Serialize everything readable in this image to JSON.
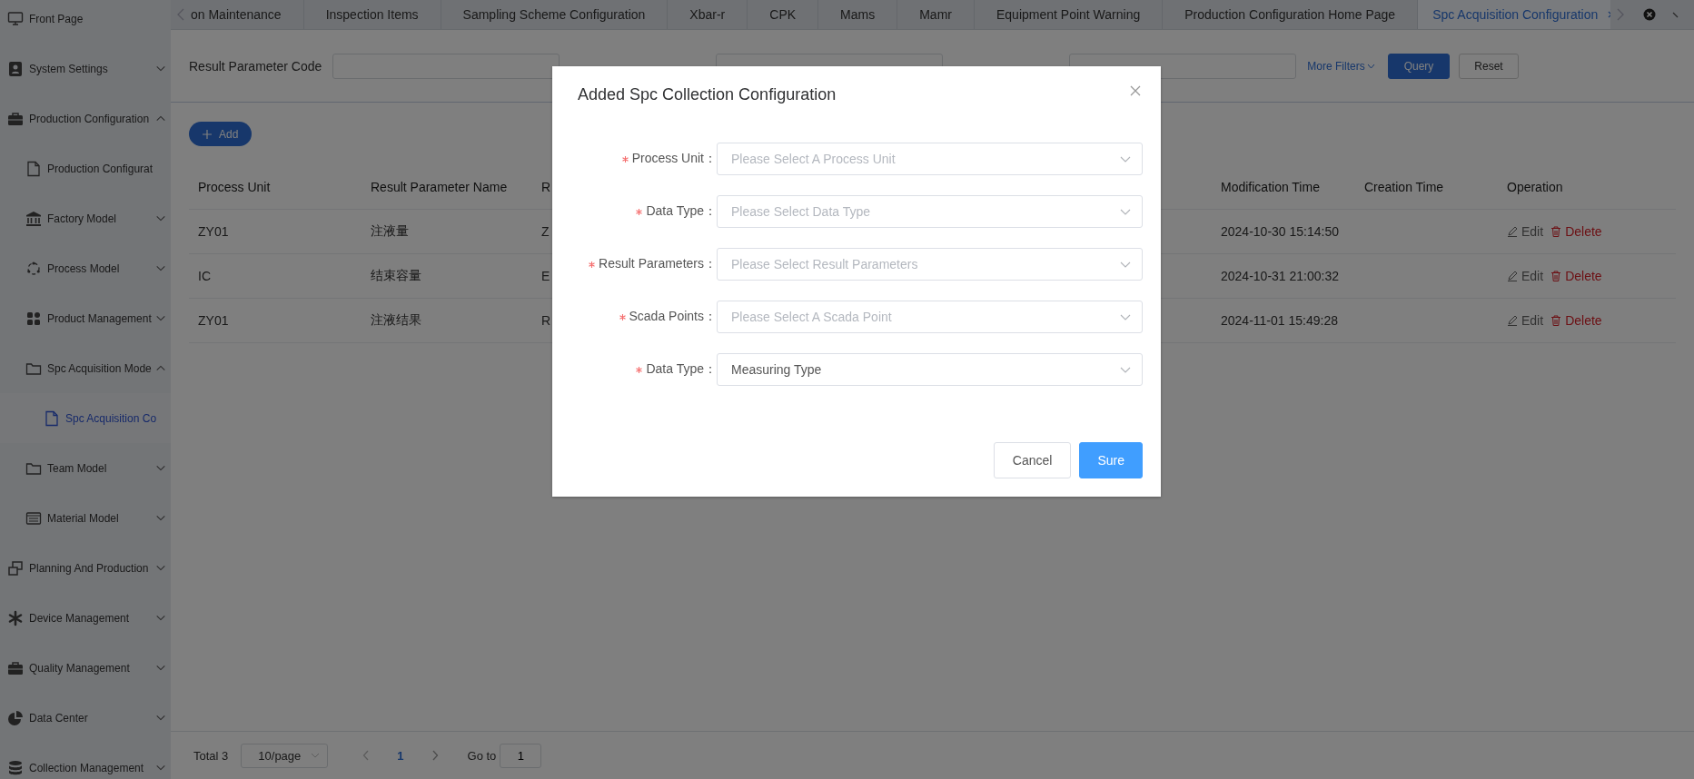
{
  "sidebar": {
    "items": [
      {
        "label": "Front Page",
        "selected": false
      },
      {
        "label": "System Settings",
        "selected": false,
        "expanded": false
      },
      {
        "label": "Production Configuration",
        "selected": false,
        "expanded": true,
        "children": [
          {
            "label": "Production Configurat",
            "selected": false
          },
          {
            "label": "Factory Model",
            "selected": false,
            "expanded": false
          },
          {
            "label": "Process Model",
            "selected": false,
            "expanded": false
          },
          {
            "label": "Product Management",
            "selected": false,
            "expanded": false
          },
          {
            "label": "Spc Acquisition Mode",
            "selected": false,
            "expanded": true,
            "children": [
              {
                "label": "Spc Acquisition Co",
                "selected": true
              }
            ]
          },
          {
            "label": "Team Model",
            "selected": false,
            "expanded": false
          },
          {
            "label": "Material Model",
            "selected": false,
            "expanded": false
          }
        ]
      },
      {
        "label": "Planning And Production",
        "selected": false,
        "expanded": false
      },
      {
        "label": "Device Management",
        "selected": false,
        "expanded": false
      },
      {
        "label": "Quality Management",
        "selected": false,
        "expanded": false
      },
      {
        "label": "Data Center",
        "selected": false,
        "expanded": false
      },
      {
        "label": "Collection Management",
        "selected": false,
        "expanded": false
      }
    ]
  },
  "tabs": [
    {
      "label": "on Maintenance",
      "selected": false
    },
    {
      "label": "Inspection Items",
      "selected": false
    },
    {
      "label": "Sampling Scheme Configuration",
      "selected": false
    },
    {
      "label": "Xbar-r",
      "selected": false
    },
    {
      "label": "CPK",
      "selected": false
    },
    {
      "label": "Mams",
      "selected": false
    },
    {
      "label": "Mamr",
      "selected": false
    },
    {
      "label": "Equipment Point Warning",
      "selected": false
    },
    {
      "label": "Production Configuration Home Page",
      "selected": false
    },
    {
      "label": "Spc Acquisition Configuration",
      "selected": true
    }
  ],
  "filters": [
    {
      "label": "Result Parameter Code"
    },
    {
      "kind": "unlabeled"
    },
    {
      "kind": "unlabeled"
    }
  ],
  "more_filters": "More Filters",
  "query_button": "Query",
  "reset_button": "Reset",
  "add_button": "Add",
  "table": {
    "columns": [
      "Process Unit",
      "Result Parameter Name",
      "R",
      "Modification Time",
      "Creation Time",
      "Operation"
    ],
    "rows": [
      {
        "cells": [
          "ZY01",
          "注液量",
          "Z",
          "2024-10-30 15:14:50"
        ],
        "actions": [
          {
            "kind": "edit",
            "label": "Edit"
          },
          {
            "kind": "delete",
            "label": "Delete"
          }
        ]
      },
      {
        "cells": [
          "IC",
          "结束容量",
          "E",
          "2024-10-31 21:00:32"
        ],
        "actions": [
          {
            "kind": "edit",
            "label": "Edit"
          },
          {
            "kind": "delete",
            "label": "Delete"
          }
        ]
      },
      {
        "cells": [
          "ZY01",
          "注液结果",
          "R",
          "2024-11-01 15:49:28"
        ],
        "actions": [
          {
            "kind": "edit",
            "label": "Edit"
          },
          {
            "kind": "delete",
            "label": "Delete"
          }
        ]
      }
    ]
  },
  "pagination": {
    "total": "Total 3",
    "page_size": "10/page",
    "pages": [
      {
        "label": "1",
        "selected": true
      }
    ],
    "goto_label": "Go to",
    "goto_value": "1"
  },
  "dialog": {
    "title": "Added Spc Collection Configuration",
    "fields": [
      {
        "label": "Process Unit：",
        "required": true,
        "placeholder": "Please Select A Process Unit"
      },
      {
        "label": "Data Type：",
        "required": true,
        "placeholder": "Please Select Data Type"
      },
      {
        "label": "Result Parameters：",
        "required": true,
        "placeholder": "Please Select Result Parameters"
      },
      {
        "label": "Scada Points：",
        "required": true,
        "placeholder": "Please Select A Scada Point"
      },
      {
        "label": "Data Type：",
        "required": true,
        "value": "Measuring Type"
      }
    ],
    "buttons": [
      {
        "kind": "cancel",
        "label": "Cancel"
      },
      {
        "kind": "primary",
        "label": "Sure"
      }
    ]
  }
}
